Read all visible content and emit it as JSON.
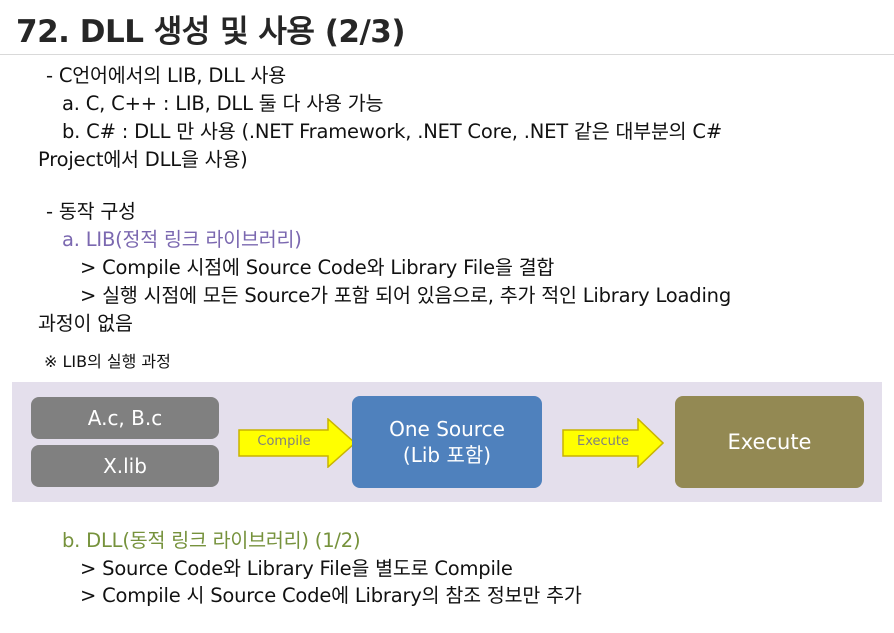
{
  "title": "72. DLL 생성 및 사용 (2/3)",
  "sections": {
    "usage": {
      "heading": "- C언어에서의 LIB, DLL 사용",
      "item_a": "a. C, C++ : LIB, DLL 둘 다 사용 가능",
      "item_b_line1": "b. C# : DLL 만 사용 (.NET Framework, .NET Core, .NET 같은 대부분의 C#",
      "item_b_line2": "Project에서 DLL을 사용)"
    },
    "structure": {
      "heading": "- 동작 구성",
      "lib_title": "a. LIB(정적 링크 라이브러리)",
      "lib_point1": "> Compile 시점에 Source Code와 Library File을 결합",
      "lib_point2_line1": "> 실행 시점에 모든 Source가 포함 되어 있음으로, 추가 적인 Library Loading",
      "lib_point2_line2": "과정이 없음"
    },
    "note": "※ LIB의 실행 과정",
    "dll": {
      "title": "b. DLL(동적 링크 라이브러리) (1/2)",
      "point1": "> Source Code와 Library File을 별도로 Compile",
      "point2": "> Compile 시 Source Code에 Library의 참조 정보만 추가"
    }
  },
  "diagram": {
    "source_box": "A.c, B.c",
    "lib_box": "X.lib",
    "arrow1_label": "Compile",
    "one_source_line1": "One Source",
    "one_source_line2": "(Lib 포함)",
    "arrow2_label": "Execute",
    "execute_box": "Execute",
    "colors": {
      "background": "#e4dfec",
      "input_box": "#808080",
      "one_source_box": "#4f81bd",
      "execute_box": "#938953",
      "arrow_fill": "#ffff00",
      "arrow_stroke": "#c8b400"
    }
  }
}
